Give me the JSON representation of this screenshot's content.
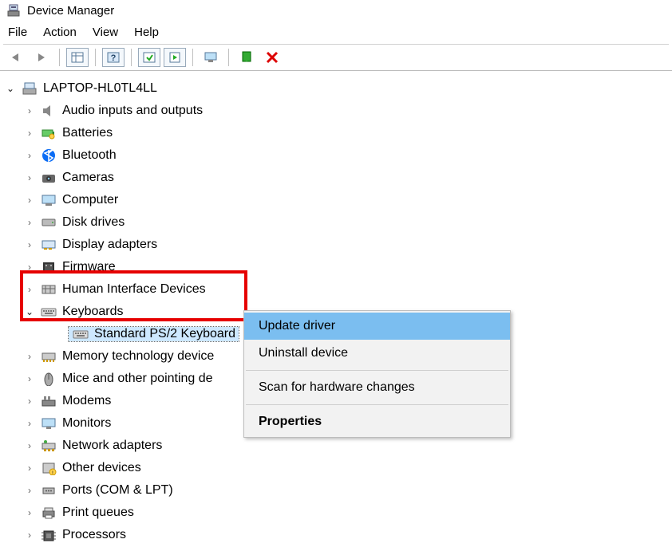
{
  "window": {
    "title": "Device Manager"
  },
  "menu": {
    "file": "File",
    "action": "Action",
    "view": "View",
    "help": "Help"
  },
  "toolbar": {
    "back": "back-icon",
    "forward": "forward-icon",
    "properties": "properties-icon",
    "refresh": "refresh-icon",
    "help": "help-icon",
    "run": "run-icon",
    "monitor": "show-hidden-icon",
    "update": "update-driver-icon",
    "delete": "delete-icon"
  },
  "tree": {
    "root": "LAPTOP-HL0TL4LL",
    "items": [
      {
        "label": "Audio inputs and outputs",
        "icon": "speaker-icon"
      },
      {
        "label": "Batteries",
        "icon": "battery-icon"
      },
      {
        "label": "Bluetooth",
        "icon": "bluetooth-icon"
      },
      {
        "label": "Cameras",
        "icon": "camera-icon"
      },
      {
        "label": "Computer",
        "icon": "computer-icon"
      },
      {
        "label": "Disk drives",
        "icon": "disk-icon"
      },
      {
        "label": "Display adapters",
        "icon": "display-adapter-icon"
      },
      {
        "label": "Firmware",
        "icon": "firmware-icon"
      },
      {
        "label": "Human Interface Devices",
        "icon": "hid-icon"
      },
      {
        "label": "Keyboards",
        "icon": "keyboard-icon",
        "expanded": true,
        "children": [
          {
            "label": "Standard PS/2 Keyboard",
            "icon": "keyboard-icon",
            "selected": true
          }
        ]
      },
      {
        "label": "Memory technology device",
        "icon": "memory-icon"
      },
      {
        "label": "Mice and other pointing de",
        "icon": "mouse-icon"
      },
      {
        "label": "Modems",
        "icon": "modem-icon"
      },
      {
        "label": "Monitors",
        "icon": "monitor-icon"
      },
      {
        "label": "Network adapters",
        "icon": "network-icon"
      },
      {
        "label": "Other devices",
        "icon": "other-icon"
      },
      {
        "label": "Ports (COM & LPT)",
        "icon": "port-icon"
      },
      {
        "label": "Print queues",
        "icon": "printer-icon"
      },
      {
        "label": "Processors",
        "icon": "processor-icon"
      }
    ]
  },
  "context_menu": {
    "items": [
      {
        "label": "Update driver",
        "highlighted": true
      },
      {
        "label": "Uninstall device"
      },
      {
        "separator": true
      },
      {
        "label": "Scan for hardware changes"
      },
      {
        "separator": true
      },
      {
        "label": "Properties",
        "bold": true
      }
    ]
  }
}
